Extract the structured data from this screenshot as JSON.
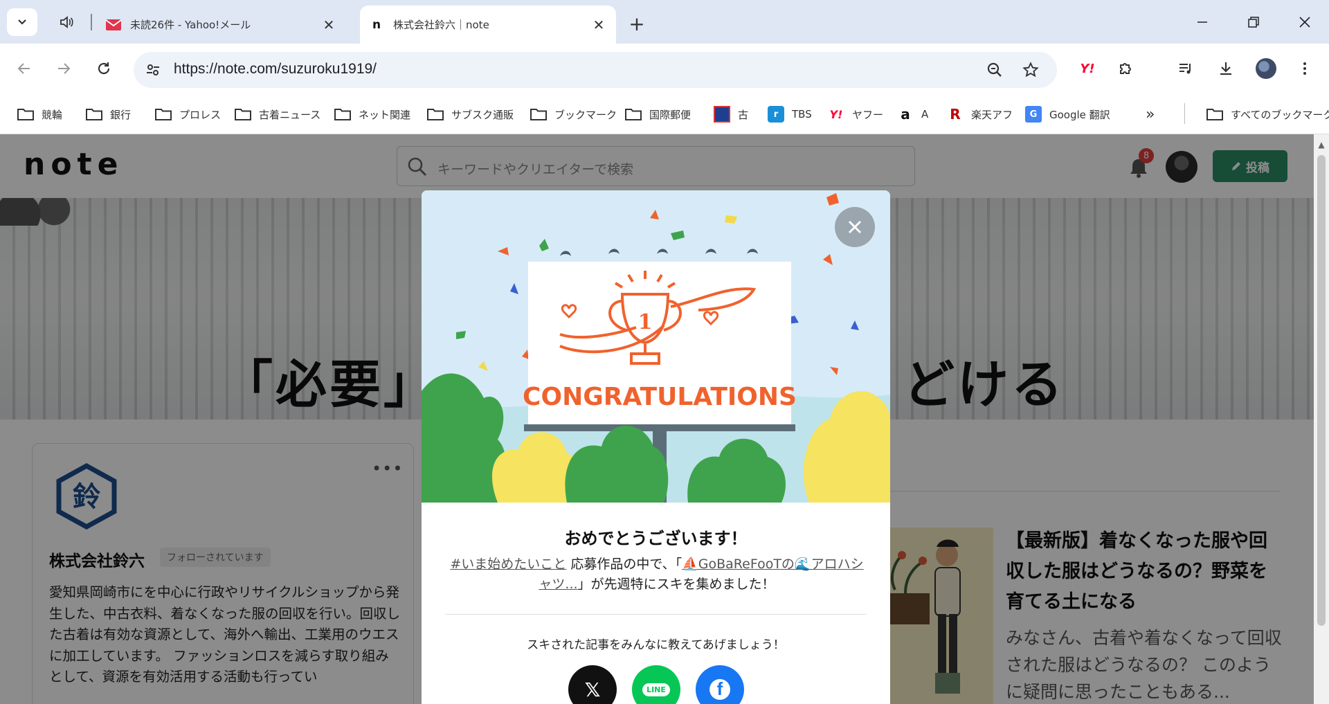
{
  "browser": {
    "tabs": [
      {
        "title": "未読26件 - Yahoo!メール",
        "favicon": "yahoo-mail-icon"
      },
      {
        "title": "株式会社鈴六｜note",
        "favicon": "note-n-icon",
        "active": true
      }
    ],
    "url": "https://note.com/suzuroku1919/",
    "bookmarks": [
      {
        "label": "競輪",
        "icon": "folder-icon"
      },
      {
        "label": "銀行",
        "icon": "folder-icon"
      },
      {
        "label": "プロレス",
        "icon": "folder-icon"
      },
      {
        "label": "古着ニュース",
        "icon": "folder-icon"
      },
      {
        "label": "ネット関連",
        "icon": "folder-icon"
      },
      {
        "label": "サブスク通販",
        "icon": "folder-icon"
      },
      {
        "label": "ブックマーク",
        "icon": "folder-icon"
      },
      {
        "label": "国際郵便",
        "icon": "folder-icon"
      },
      {
        "label": "古",
        "icon": "furugi-icon"
      },
      {
        "label": "TBS",
        "icon": "radiko-icon"
      },
      {
        "label": "ヤフー",
        "icon": "yahoo-icon"
      },
      {
        "label": "A",
        "icon": "amazon-icon"
      },
      {
        "label": "楽天アフ",
        "icon": "rakuten-icon"
      },
      {
        "label": "Google 翻訳",
        "icon": "google-translate-icon"
      }
    ],
    "all_bookmarks_label": "すべてのブックマーク",
    "colors": {
      "tabstrip": "#dfe7f5",
      "omnibox": "#eef2f9"
    }
  },
  "note": {
    "logo": "note",
    "search_placeholder": "キーワードやクリエイターで検索",
    "notification_count": "8",
    "post_label": "投稿",
    "brand_color": "#2b8a63",
    "hero": {
      "left_text": "「必要」を",
      "right_text": "どける"
    },
    "profile": {
      "logo_char": "鈴",
      "more": "•••",
      "name": "株式会社鈴六",
      "follow_status": "フォローされています",
      "description": "愛知県岡崎市にを中心に行政やリサイクルショップから発生した、中古衣料、着なくなった服の回収を行い。回収した古着は有効な資源として、海外へ輸出、工業用のウエスに加工しています。 ファッションロスを減らす取り組みとして、資源を有効活用する活動も行ってい"
    },
    "article": {
      "title": "【最新版】着なくなった服や回収した服はどうなるの？野菜を育てる土になる",
      "excerpt": "みなさん、古着や着なくなって回収された服はどうなるの？ このように疑問に思ったこともある..."
    }
  },
  "modal": {
    "banner_text": "CONGRATULATIONS",
    "trophy_number": "1",
    "heading": "おめでとうございます！",
    "hashtag": "#いま始めたいこと",
    "text_mid": "応募作品の中で、「",
    "article_link": "⛵GoBaReFooTの🌊アロハシャツ...",
    "text_end": "」が先週特にスキを集めました！",
    "share_prompt": "スキされた記事をみんなに教えてあげましょう！",
    "share": {
      "x": "𝕏",
      "line": "LINE",
      "facebook": "f"
    },
    "colors": {
      "x": "#111111",
      "line": "#06c755",
      "facebook": "#1877f2",
      "accent": "#f0622d"
    }
  }
}
